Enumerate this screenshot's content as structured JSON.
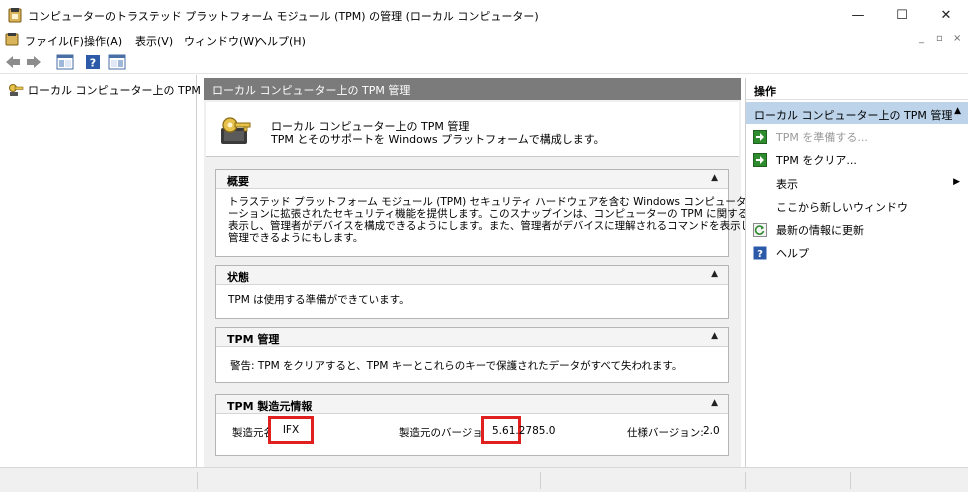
{
  "window": {
    "title": "コンピューターのトラステッド プラットフォーム モジュール (TPM) の管理 (ローカル コンピューター)",
    "minimize": "—",
    "maximize": "☐",
    "close": "✕"
  },
  "menu": {
    "items": [
      "ファイル(F)",
      "操作(A)",
      "表示(V)",
      "ウィンドウ(W)",
      "ヘルプ(H)"
    ],
    "mdi_minimize": "_",
    "mdi_restore": "▫",
    "mdi_close": "×"
  },
  "tree": {
    "root_label": "ローカル コンピューター上の TPM 管理"
  },
  "center": {
    "header": "ローカル コンピューター上の TPM 管理",
    "intro_title": "ローカル コンピューター上の TPM 管理",
    "intro_desc": "TPM とそのサポートを Windows プラットフォームで構成します。",
    "overview": {
      "title": "概要",
      "lines": [
        "トラステッド プラットフォーム モジュール (TPM) セキュリティ ハードウェアを含む Windows コンピューターはアプリケ",
        "ーションに拡張されたセキュリティ機能を提供します。このスナップインは、コンピューターの TPM に関する情報を",
        "表示し、管理者がデバイスを構成できるようにします。また、管理者がデバイスに理解されるコマンドを表示して",
        "管理できるようにもします。"
      ]
    },
    "status": {
      "title": "状態",
      "text": "TPM は使用する準備ができています。"
    },
    "tpm_mgmt": {
      "title": "TPM 管理",
      "text": "警告: TPM をクリアすると、TPM キーとこれらのキーで保護されたデータがすべて失われます。"
    },
    "manufacturer": {
      "title": "TPM 製造元情報",
      "name_label": "製造元名:",
      "name_value": "IFX",
      "version_label": "製造元のバージョン:",
      "version_value": "5.61.2785.0",
      "spec_label": "仕様バージョン:",
      "spec_value": "2.0"
    },
    "toggle_glyph": "▲"
  },
  "actions": {
    "header": "操作",
    "section": "ローカル コンピューター上の TPM 管理",
    "section_caret": "▲",
    "items": [
      {
        "label": "TPM を準備する...",
        "icon": "green-arrow-icon",
        "disabled": true
      },
      {
        "label": "TPM をクリア...",
        "icon": "green-arrow-icon",
        "disabled": false
      },
      {
        "label": "表示",
        "icon": "",
        "disabled": false,
        "submenu": true
      },
      {
        "label": "ここから新しいウィンドウ",
        "icon": "",
        "disabled": false
      },
      {
        "label": "最新の情報に更新",
        "icon": "refresh-icon",
        "disabled": false
      },
      {
        "label": "ヘルプ",
        "icon": "help-icon",
        "disabled": false
      }
    ],
    "submenu_arrow": "▶"
  },
  "colors": {
    "accent_selected": "#bcd3ea",
    "header_gray": "#7b7b7b",
    "highlight_red": "#e0201f"
  }
}
